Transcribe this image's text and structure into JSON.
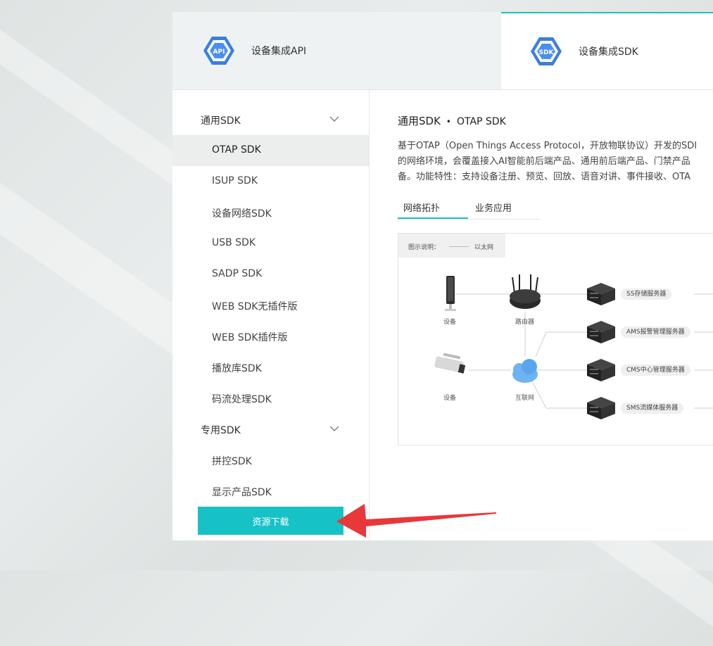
{
  "tabs": [
    {
      "label": "设备集成API",
      "icon_text": "API"
    },
    {
      "label": "设备集成SDK",
      "icon_text": "SDK"
    }
  ],
  "sidebar": {
    "group1": {
      "label": "通用SDK"
    },
    "items1": [
      {
        "label": "OTAP SDK",
        "active": true
      },
      {
        "label": "ISUP SDK"
      },
      {
        "label": "设备网络SDK"
      },
      {
        "label": "USB SDK"
      },
      {
        "label": "SADP SDK"
      },
      {
        "label": "WEB SDK无插件版"
      },
      {
        "label": "WEB SDK插件版"
      },
      {
        "label": "播放库SDK"
      },
      {
        "label": "码流处理SDK"
      }
    ],
    "group2": {
      "label": "专用SDK"
    },
    "items2": [
      {
        "label": "拼控SDK"
      },
      {
        "label": "显示产品SDK"
      }
    ],
    "download_label": "资源下载"
  },
  "main": {
    "crumb_parent": "通用SDK",
    "crumb_sep": "•",
    "crumb_current": "OTAP SDK",
    "desc_lines": [
      "基于OTAP（Open Things Access Protocol，开放物联协议）开发的SDI",
      "的网络环境，会覆盖接入AI智能前后端产品、通用前后端产品、门禁产品",
      "备。功能特性：支持设备注册、预览、回放、语音对讲、事件接收、OTA"
    ],
    "subtabs": [
      "网络拓扑",
      "业务应用"
    ],
    "diagram": {
      "legend_title": "图示说明：",
      "legend_item": "以太网",
      "device1": "设备",
      "router": "路由器",
      "device2": "设备",
      "internet": "互联网",
      "servers": [
        "SS存储服务器",
        "AMS报警管理服务器",
        "CMS中心管理服务器",
        "SMS流媒体服务器"
      ]
    }
  },
  "colors": {
    "accent": "#17c2c7",
    "arrow": "#e8383a"
  }
}
